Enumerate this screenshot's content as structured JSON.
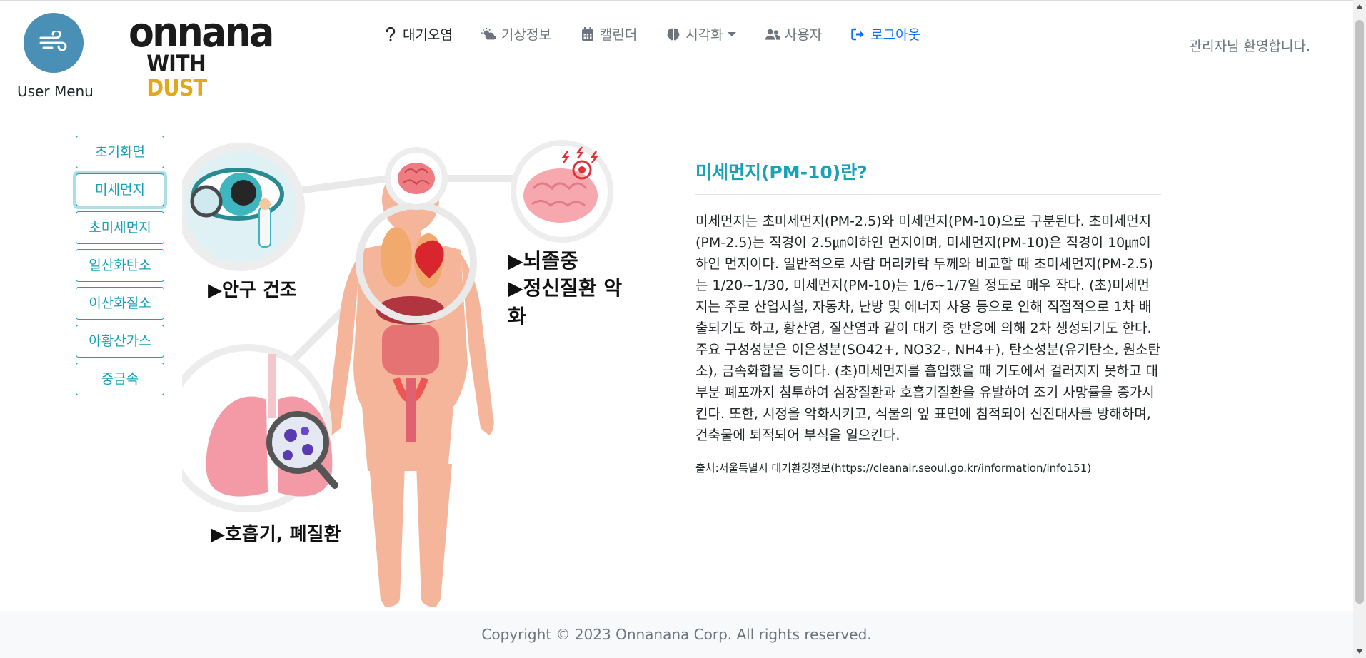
{
  "header": {
    "user_menu_label": "User Menu",
    "logo_line1": "onnana",
    "logo_line2_with": "WITH ",
    "logo_line2_dust": "DUST",
    "welcome": "관리자님 환영합니다."
  },
  "nav": {
    "items": [
      {
        "label": "대기오염",
        "icon": "question-icon"
      },
      {
        "label": "기상정보",
        "icon": "cloud-sun-icon"
      },
      {
        "label": "캘린더",
        "icon": "calendar-icon"
      },
      {
        "label": "시각화",
        "icon": "brain-icon"
      },
      {
        "label": "사용자",
        "icon": "users-icon"
      },
      {
        "label": "로그아웃",
        "icon": "sign-out-icon"
      }
    ]
  },
  "sidebar": {
    "items": [
      {
        "label": "초기화면"
      },
      {
        "label": "미세먼지"
      },
      {
        "label": "초미세먼지"
      },
      {
        "label": "일산화탄소"
      },
      {
        "label": "이산화질소"
      },
      {
        "label": "아황산가스"
      },
      {
        "label": "중금속"
      }
    ]
  },
  "illustration": {
    "eye_label": "▶안구 건조",
    "brain_labels_1": "▶뇌졸중",
    "brain_labels_2": "▶정신질환 악화",
    "lung_label": "▶호흡기, 폐질환"
  },
  "article": {
    "title": "미세먼지(PM-10)란?",
    "body": "미세먼지는 초미세먼지(PM-2.5)와 미세먼지(PM-10)으로 구분된다. 초미세먼지(PM-2.5)는 직경이 2.5㎛이하인 먼지이며, 미세먼지(PM-10)은 직경이 10㎛이하인 먼지이다. 일반적으로 사람 머리카락 두께와 비교할 때 초미세먼지(PM-2.5)는 1/20~1/30, 미세먼지(PM-10)는 1/6~1/7일 정도로 매우 작다. (초)미세먼지는 주로 산업시설, 자동차, 난방 및 에너지 사용 등으로 인해 직접적으로 1차 배출되기도 하고, 황산염, 질산염과 같이 대기 중 반응에 의해 2차 생성되기도 한다. 주요 구성성분은 이온성분(SO42+, NO32-, NH4+), 탄소성분(유기탄소, 원소탄소), 금속화합물 등이다. (초)미세먼지를 흡입했을 때 기도에서 걸러지지 못하고 대부분 폐포까지 침투하여 심장질환과 호흡기질환을 유발하여 조기 사망률을 증가시킨다. 또한, 시정을 악화시키고, 식물의 잎 표면에 침적되어 신진대사를 방해하며, 건축물에 퇴적되어 부식을 일으킨다.",
    "source": "출처:서울특별시 대기환경정보(https://cleanair.seoul.go.kr/information/info151)"
  },
  "footer": {
    "copyright": "Copyright © 2023 Onnanana Corp. All rights reserved."
  },
  "colors": {
    "accent": "#17a2b8",
    "link": "#0d6efd",
    "logo_dust": "#e2a81c",
    "user_circle": "#4a8fb5"
  }
}
